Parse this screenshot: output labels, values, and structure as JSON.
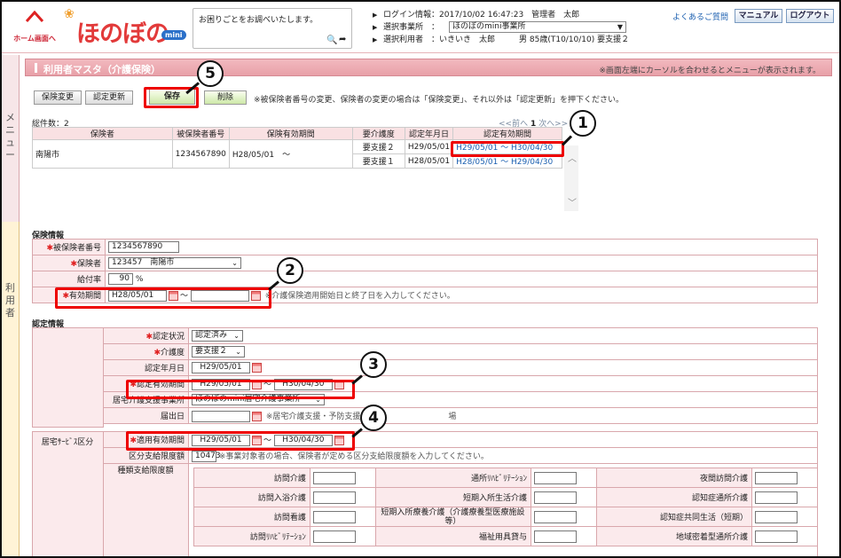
{
  "header": {
    "home_label": "ホーム画面へ",
    "logo_text": "ほのぼの",
    "logo_badge": "mini",
    "search_text": "お困りごとをお調べいたします。",
    "login_label": "ログイン情報：",
    "login_value": "2017/10/02 16:47:23　管理者　太郎",
    "office_label": "選択事業所　：",
    "office_value": "ほのぼのmini事業所",
    "user_label": "選択利用者　：",
    "user_value": "いきいき　太郎　　　男 85歳(T10/10/10) 要支援２",
    "faq_link": "よくあるご質問",
    "manual_button": "マニュアル",
    "logout_button": "ログアウト"
  },
  "side": {
    "menu_label": "メニュー",
    "user_label": "利用者"
  },
  "page": {
    "title": "利用者マスタ（介護保険）",
    "title_note": "※画面左端にカーソルを合わせるとメニューが表示されます。",
    "buttons": {
      "change": "保険変更",
      "update": "認定更新",
      "save": "保存",
      "delete": "削除"
    },
    "button_note": "※被保険者番号の変更、保険者の変更の場合は「保険変更」、それ以外は「認定更新」を押下ください。",
    "total": "総件数：2",
    "pager": {
      "prev": "<<前へ",
      "current": "1",
      "next": "次へ>>"
    }
  },
  "ins_table": {
    "headers": [
      "保険者",
      "被保険者番号",
      "保険有効期間",
      "要介護度",
      "認定年月日",
      "認定有効期間"
    ],
    "row": {
      "insurer": "南陽市",
      "number": "1234567890",
      "period": "H28/05/01　～"
    },
    "subrows": [
      {
        "level": "要支援２",
        "date": "H29/05/01",
        "valid": "H29/05/01 ～ H30/04/30"
      },
      {
        "level": "要支援１",
        "date": "H28/05/01",
        "valid": "H28/05/01 ～ H29/04/30"
      }
    ]
  },
  "insurance": {
    "section_title": "保険情報",
    "number_label": "被保険者番号",
    "number_value": "1234567890",
    "insurer_label": "保険者",
    "insurer_value": "123457　南陽市",
    "rate_label": "給付率",
    "rate_value": "90",
    "rate_unit": "%",
    "period_label": "有効期間",
    "period_from": "H28/05/01",
    "period_tilde": "～",
    "period_to": "",
    "period_note": "※介護保険適用開始日と終了日を入力してください。"
  },
  "cert": {
    "section_title": "認定情報",
    "status_label": "認定状況",
    "status_value": "認定済み",
    "level_label": "介護度",
    "level_value": "要支援２",
    "date_label": "認定年月日",
    "date_value": "H29/05/01",
    "valid_label": "認定有効期間",
    "valid_from": "H29/05/01",
    "valid_to": "H30/04/30",
    "tilde": "～",
    "office_label": "居宅介護支援事業所",
    "office_value": "ほのぼのmini居宅介護事業所",
    "notify_label": "届出日",
    "notify_value": "",
    "notify_note": "※居宅介護支援・予防支援　　　　　　　　　　　場",
    "service_label": "居宅ｻｰﾋﾞｽ区分",
    "applied_label": "適用有効期間",
    "applied_from": "H29/05/01",
    "applied_to": "H30/04/30",
    "limit_label": "区分支給限度額",
    "limit_value": "10473",
    "limit_note": "※事業対象者の場合、保険者が定める区分支給限度額を入力してください。",
    "kind_label": "種類支給限度額",
    "services": [
      [
        "訪問介護",
        "通所ﾘﾊﾋﾞﾘﾃｰｼｮﾝ",
        "夜間訪問介護"
      ],
      [
        "訪問入浴介護",
        "短期入所生活介護",
        "認知症通所介護"
      ],
      [
        "訪問看護",
        "短期入所療養介護（介護療養型医療施設等）",
        "認知症共同生活（短期）"
      ],
      [
        "訪問ﾘﾊﾋﾞﾘﾃｰｼｮﾝ",
        "福祉用具貸与",
        "地域密着型通所介護"
      ]
    ]
  },
  "callouts": [
    "1",
    "2",
    "3",
    "4",
    "5"
  ]
}
